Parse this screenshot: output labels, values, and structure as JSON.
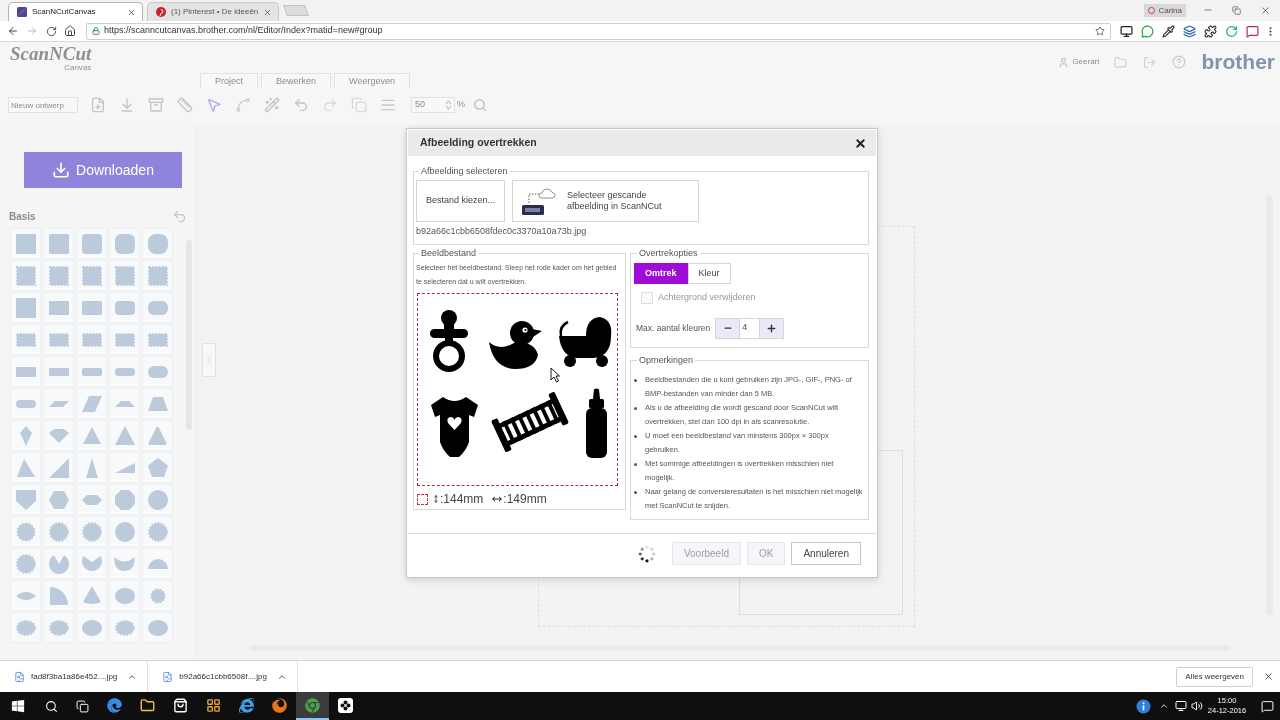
{
  "browser": {
    "tabs": [
      {
        "title": "ScanNCutCanvas",
        "selected": true
      },
      {
        "title": "(1) Pinterest • De ideeën",
        "selected": false
      }
    ],
    "profile": "Carina",
    "url": "https://scanncutcanvas.brother.com/nl/Editor/Index?matid=new#group"
  },
  "app": {
    "logo": "ScanNCut",
    "logo_subtitle": "Canvas",
    "menu_tabs": [
      {
        "label": "Project"
      },
      {
        "label": "Bewerken"
      },
      {
        "label": "Weergeven"
      }
    ],
    "design_name": {
      "placeholder": "Nieuw ontwerp"
    },
    "zoom": {
      "value": "50",
      "unit": "%"
    },
    "user": "Geerart",
    "brand": "brother",
    "download_button": "Downloaden",
    "shape_category": "Basis"
  },
  "dialog": {
    "title": "Afbeelding overtrekken",
    "select_image": {
      "legend": "Afbeelding selecteren",
      "file_button": "Bestand kiezen...",
      "scan_button": "Selecteer gescande afbeelding in ScanNCut",
      "file_name": "b92a66c1cbb6508fdec0c3370a10a73b.jpg"
    },
    "image_file": {
      "legend": "Beeldbestand",
      "instructions": "Selecteer het beeldbestand. Sleep het rode kader om het gebied te selecteren dat u wilt overtrekken.",
      "height": ":144mm",
      "width": ":149mm"
    },
    "trace_options": {
      "legend": "Overtrekopties",
      "modes": [
        {
          "label": "Omtrek",
          "selected": true
        },
        {
          "label": "Kleur",
          "selected": false
        }
      ],
      "remove_background": {
        "label": "Achtergrond verwijderen",
        "checked": false,
        "disabled": true
      },
      "max_colors": {
        "label": "Max. aantal kleuren",
        "value": "4"
      }
    },
    "notes": {
      "legend": "Opmerkingen",
      "items": [
        "Beeldbestanden die u kunt gebruiken zijn JPG-, GIF-, PNG- of BMP-bestanden van minder dan 5 MB.",
        "Als u de afbeelding die wordt gescand door ScanNCut wilt overtrekken, stel dan 100 dpi in als scanresolutie.",
        "U moet een beeldbestand van minstens 300px × 300px gebruiken.",
        "Met sommige afbeeldingen is overtrekken misschien niet mogelijk.",
        "Naar gelang de conversieresultaten is het misschien niet mogelijk met ScanNCut te snijden."
      ]
    },
    "busy": true,
    "buttons": [
      {
        "label": "Voorbeeld",
        "disabled": true
      },
      {
        "label": "OK",
        "disabled": true
      },
      {
        "label": "Annuleren",
        "disabled": false
      }
    ]
  },
  "downloads": {
    "files": [
      "fad8f3ba1a86e452....jpg",
      "b92a66c1cbb6508f....jpg"
    ],
    "show_all": "Alles weergeven"
  },
  "taskbar": {
    "apps": [
      {
        "active": false
      },
      {
        "active": false
      },
      {
        "active": false
      },
      {
        "active": false
      },
      {
        "active": false
      },
      {
        "active": false
      },
      {
        "active": true
      },
      {
        "active": false
      }
    ],
    "time": "15:00",
    "date": "24-12-2016"
  }
}
